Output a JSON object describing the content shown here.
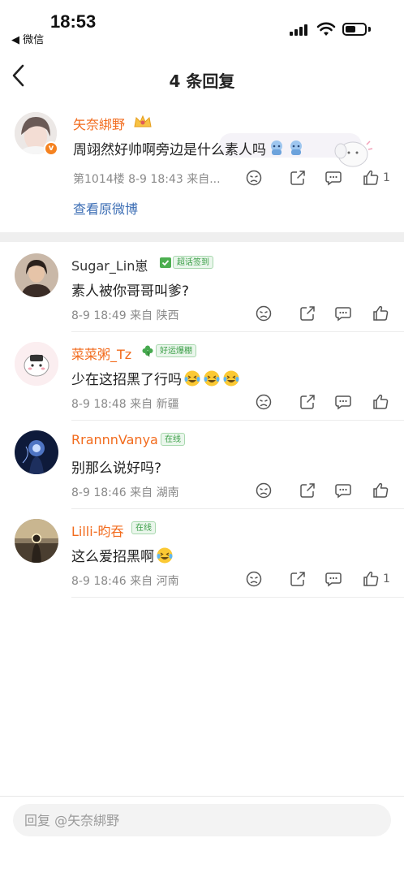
{
  "status": {
    "time": "18:53",
    "back_app": "◀ 微信"
  },
  "nav": {
    "title": "4 条回复"
  },
  "main_comment": {
    "username": "矢奈綁野",
    "text": "周翊然好帅啊旁边是什么素人吗",
    "floor": "第1014楼",
    "datetime": "8-9 18:43",
    "location": "来自...",
    "like_count": "1",
    "view_original": "查看原微博"
  },
  "replies": [
    {
      "username": "Sugar_Lin崽",
      "badge": "超话签到",
      "text": "素人被你哥哥叫爹?",
      "datetime": "8-9 18:49",
      "location": "来自 陕西",
      "like_count": ""
    },
    {
      "username": "菜菜粥_Tz",
      "badge": "好运爆棚",
      "text": "少在这招黑了行吗",
      "datetime": "8-9 18:48",
      "location": "来自 新疆",
      "like_count": ""
    },
    {
      "username": "RrannnVanya",
      "badge": "在线",
      "text": "别那么说好吗?",
      "datetime": "8-9 18:46",
      "location": "来自 湖南",
      "like_count": ""
    },
    {
      "username": "Lilli-昀吞",
      "badge": "在线",
      "text": "这么爱招黑啊",
      "datetime": "8-9 18:46",
      "location": "来自 河南",
      "like_count": "1"
    }
  ],
  "input": {
    "placeholder": "回复 @矢奈綁野"
  },
  "colors": {
    "orange_name": "#f26b1d",
    "link_blue": "#3b6db4",
    "verified_orange": "#f58220",
    "badge_green": "#3a9e46"
  }
}
